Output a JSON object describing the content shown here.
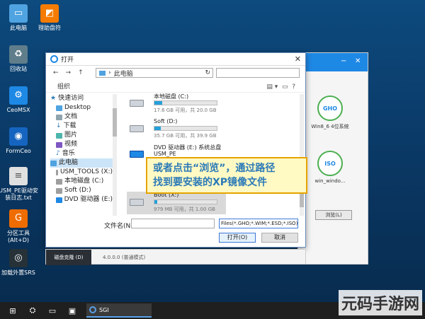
{
  "desktop_icons": [
    {
      "label": "此电脑",
      "icon": "computer-icon",
      "color": "#4fa3e0"
    },
    {
      "label": "理助盘符",
      "icon": "partition-tool-icon",
      "color": "#f57c00"
    },
    {
      "label": "回收站",
      "icon": "recycle-bin-icon",
      "color": "#607d8b"
    },
    {
      "label": "CeoMSX",
      "icon": "gear-icon",
      "color": "#1e88e5"
    },
    {
      "label": "FormCeo",
      "icon": "formceo-icon",
      "color": "#1565c0"
    },
    {
      "label": "USM_PE驱动安装日志.txt",
      "icon": "text-file-icon",
      "color": "#e0e0e0"
    },
    {
      "label": "分区工具(Alt+D)",
      "icon": "partition-icon",
      "color": "#ef6c00"
    },
    {
      "label": "加载外置SRS",
      "icon": "srs-icon",
      "color": "#263238"
    }
  ],
  "dialog": {
    "title": "打开",
    "address": "此电脑",
    "organize": "组织",
    "nav": [
      {
        "label": "快速访问",
        "icon": "star-icon"
      },
      {
        "label": "Desktop",
        "icon": "desktop-icon"
      },
      {
        "label": "文档",
        "icon": "document-icon"
      },
      {
        "label": "下载",
        "icon": "download-icon"
      },
      {
        "label": "图片",
        "icon": "picture-icon"
      },
      {
        "label": "视频",
        "icon": "video-icon"
      },
      {
        "label": "音乐",
        "icon": "music-icon"
      },
      {
        "label": "此电脑",
        "icon": "computer-icon"
      },
      {
        "label": "USM_TOOLS (X:)",
        "icon": "drive-icon"
      },
      {
        "label": "本地磁盘 (C:)",
        "icon": "drive-icon"
      },
      {
        "label": "Soft (D:)",
        "icon": "drive-icon"
      },
      {
        "label": "DVD 驱动器 (E:)",
        "icon": "dvd-icon"
      }
    ],
    "drives": [
      {
        "name": "本地磁盘 (C:)",
        "size": "17.6 GB 可用，共 20.0 GB",
        "used": 0.12
      },
      {
        "name": "Soft (D:)",
        "size": "35.7 GB 可用，共 39.9 GB",
        "used": 0.1
      },
      {
        "name": "DVD 驱动器 (E:) 系统总盘",
        "sub": "USM_PE",
        "size": ""
      },
      {
        "name": "Boot (X:)",
        "size": "979 MB 可用，共 1.00 GB",
        "used": 0.05
      }
    ],
    "filename_label": "文件名(N):",
    "filename_value": "",
    "filter": "Files(*.GHO;*.WIM;*.ESD;*.ISO)",
    "open_label": "打开(O)",
    "cancel_label": "取消"
  },
  "callout": {
    "line1": "或者点击“浏览”，通过路径",
    "line2": "找到要安装的XP镜像文件"
  },
  "bg_app": {
    "option1": "Win8_6 4位系统",
    "option2": "win_windo...",
    "browse": "浏览(L)",
    "disc1": "GHO",
    "disc2": "ISO"
  },
  "status": {
    "tab": "磁盘克隆 (D)",
    "version": "4.0.0.0 (普通模式)"
  },
  "taskbar": {
    "app_label": "SGI"
  },
  "watermark": "元码手游网"
}
